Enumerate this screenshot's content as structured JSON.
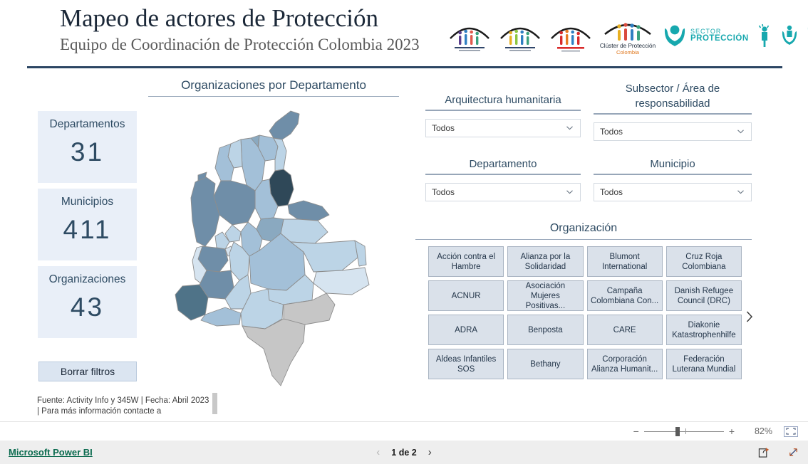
{
  "header": {
    "title": "Mapeo de actores de Protección",
    "subtitle": "Equipo de Coordinación de Protección Colombia 2023",
    "logos": {
      "cluster_name": "Clúster de Protección",
      "cluster_country": "Colombia",
      "sector_top": "SECTOR",
      "sector_bottom": "PROTECCIÓN"
    }
  },
  "kpis": [
    {
      "label": "Departamentos",
      "value": "31"
    },
    {
      "label": "Municipios",
      "value": "411"
    },
    {
      "label": "Organizaciones",
      "value": "43"
    }
  ],
  "clear_filters_label": "Borrar filtros",
  "source_note": "Fuente: Activity Info y 345W  |  Fecha: Abril 2023  |  Para más información contacte a",
  "map": {
    "title": "Organizaciones por Departamento"
  },
  "slicers": [
    {
      "label": "Arquitectura humanitaria",
      "value": "Todos"
    },
    {
      "label": "Subsector / Área de responsabilidad",
      "value": "Todos"
    },
    {
      "label": "Departamento",
      "value": "Todos"
    },
    {
      "label": "Municipio",
      "value": "Todos"
    }
  ],
  "organization": {
    "title": "Organización",
    "tiles": [
      "Acción contra el Hambre",
      "Alianza por la Solidaridad",
      "Blumont International",
      "Cruz Roja Colombiana",
      "ACNUR",
      "Asociación Mujeres Positivas...",
      "Campaña Colombiana Con...",
      "Danish Refugee Council (DRC)",
      "ADRA",
      "Benposta",
      "CARE",
      "Diakonie Katastrophenhilfe",
      "Aldeas Infantiles SOS",
      "Bethany",
      "Corporación Alianza Humanit...",
      "Federación Luterana Mundial"
    ]
  },
  "footer": {
    "zoom_minus": "−",
    "zoom_plus": "+",
    "zoom_level": "82%",
    "powerbi_label": "Microsoft Power BI",
    "page_label": "1 de 2"
  },
  "colors": {
    "accent": "#2e4b63",
    "kpi_bg": "#e9eff8",
    "tile_bg": "#dae1ea",
    "teal": "#17a8ae",
    "powerbi_green": "#0b6b4f"
  },
  "chart_data": {
    "type": "heatmap",
    "title": "Organizaciones por Departamento",
    "subtitle": "Mapa coroplético de Colombia",
    "value_label": "Organizaciones",
    "legend_position": "none",
    "no_data_color": "#c6c6c6",
    "scale": [
      "#d6e4f0",
      "#bcd4e6",
      "#a3c0d8",
      "#8aa9c0",
      "#6f8ea8",
      "#4f7388",
      "#2f4858"
    ],
    "regions": [
      {
        "name": "La Guajira",
        "level": 5,
        "color": "#6f8ea8"
      },
      {
        "name": "Atlántico",
        "level": 4,
        "color": "#8aa9c0"
      },
      {
        "name": "Magdalena",
        "level": 3,
        "color": "#a3c0d8"
      },
      {
        "name": "Cesar",
        "level": 2,
        "color": "#bcd4e6"
      },
      {
        "name": "Bolívar",
        "level": 3,
        "color": "#a3c0d8"
      },
      {
        "name": "Sucre",
        "level": 2,
        "color": "#bcd4e6"
      },
      {
        "name": "Córdoba",
        "level": 3,
        "color": "#a3c0d8"
      },
      {
        "name": "Norte de Santander",
        "level": 7,
        "color": "#2f4858"
      },
      {
        "name": "Santander",
        "level": 3,
        "color": "#a3c0d8"
      },
      {
        "name": "Antioquia",
        "level": 5,
        "color": "#6f8ea8"
      },
      {
        "name": "Chocó",
        "level": 5,
        "color": "#6f8ea8"
      },
      {
        "name": "Arauca",
        "level": 5,
        "color": "#6f8ea8"
      },
      {
        "name": "Casanare",
        "level": 2,
        "color": "#bcd4e6"
      },
      {
        "name": "Boyacá",
        "level": 4,
        "color": "#8aa9c0"
      },
      {
        "name": "Cundinamarca",
        "level": 3,
        "color": "#a3c0d8"
      },
      {
        "name": "Caldas",
        "level": 2,
        "color": "#bcd4e6"
      },
      {
        "name": "Risaralda",
        "level": 2,
        "color": "#bcd4e6"
      },
      {
        "name": "Quindío",
        "level": 1,
        "color": "#d6e4f0"
      },
      {
        "name": "Tolima",
        "level": 2,
        "color": "#bcd4e6"
      },
      {
        "name": "Valle del Cauca",
        "level": 5,
        "color": "#6f8ea8"
      },
      {
        "name": "Cauca",
        "level": 5,
        "color": "#6f8ea8"
      },
      {
        "name": "Nariño",
        "level": 6,
        "color": "#4f7388"
      },
      {
        "name": "Putumayo",
        "level": 3,
        "color": "#a3c0d8"
      },
      {
        "name": "Huila",
        "level": 2,
        "color": "#bcd4e6"
      },
      {
        "name": "Caquetá",
        "level": 2,
        "color": "#bcd4e6"
      },
      {
        "name": "Meta",
        "level": 3,
        "color": "#a3c0d8"
      },
      {
        "name": "Vichada",
        "level": 2,
        "color": "#bcd4e6"
      },
      {
        "name": "Guainía",
        "level": 1,
        "color": "#d6e4f0"
      },
      {
        "name": "Guaviare",
        "level": 2,
        "color": "#bcd4e6"
      },
      {
        "name": "Vaupés",
        "level": 0,
        "color": "#c6c6c6"
      },
      {
        "name": "Amazonas",
        "level": 0,
        "color": "#c6c6c6"
      }
    ]
  }
}
